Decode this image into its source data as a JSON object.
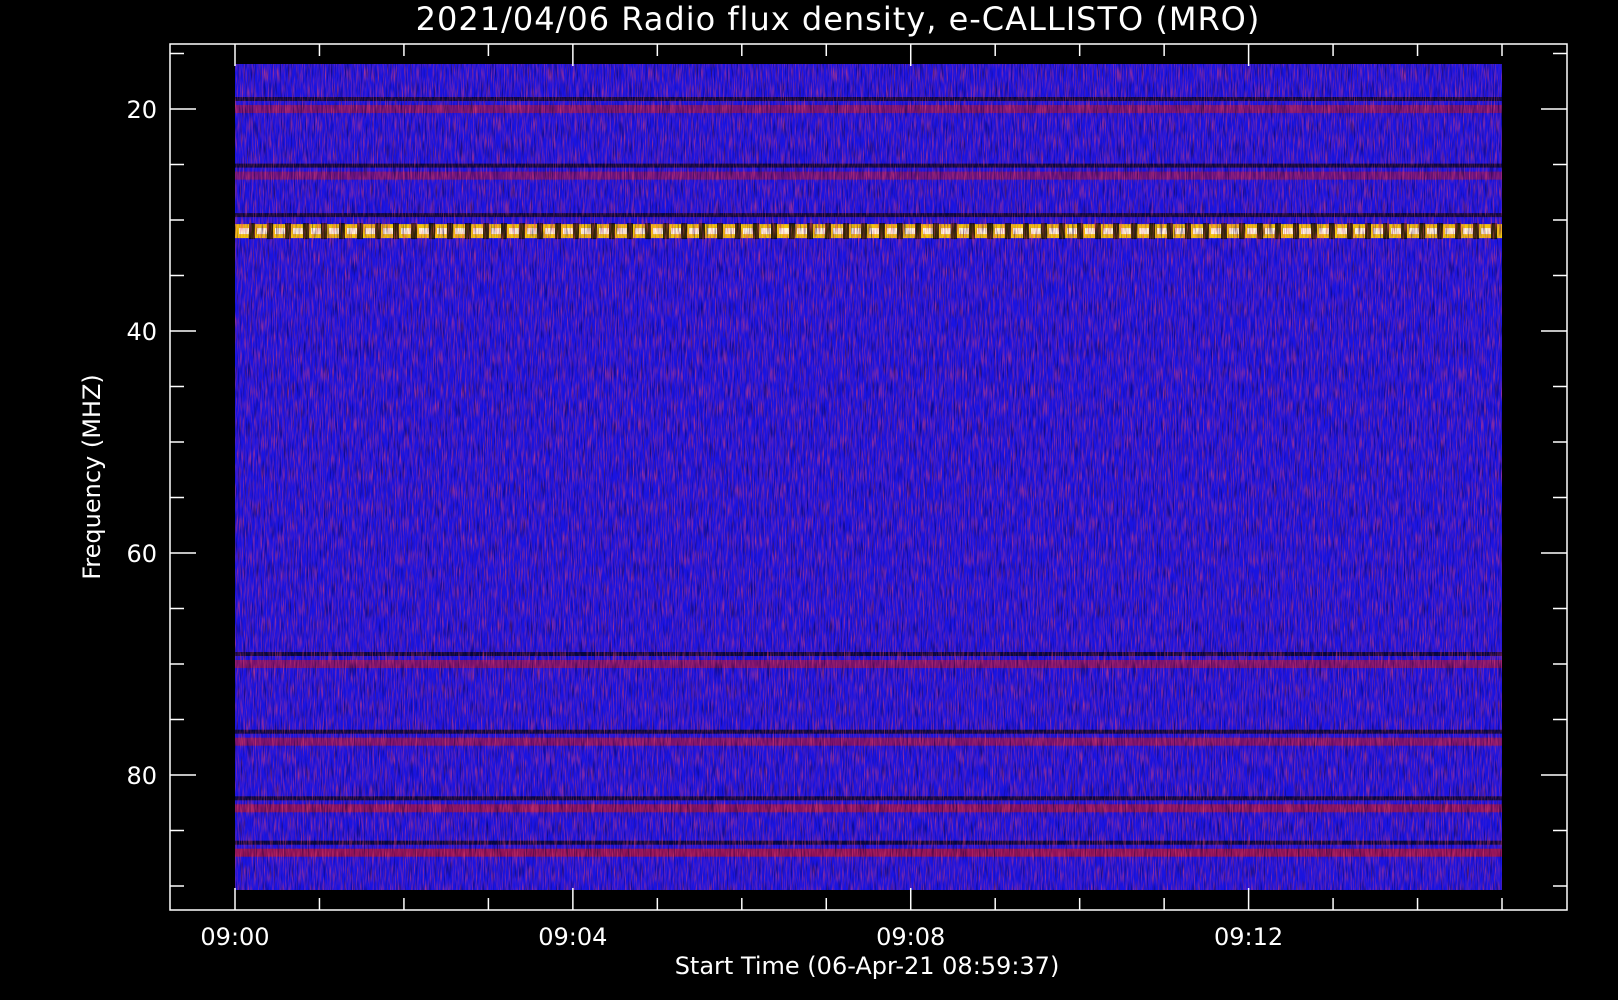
{
  "chart_data": {
    "type": "heatmap",
    "title": "2021/04/06  Radio flux density, e-CALLISTO (MRO)",
    "xlabel": "Start Time (06-Apr-21 08:59:37)",
    "ylabel": "Frequency (MHZ)",
    "x_ticks": [
      "09:00",
      "09:04",
      "09:08",
      "09:12"
    ],
    "x_tick_minutes": [
      0,
      4,
      8,
      12
    ],
    "x_range_minutes": [
      0,
      15
    ],
    "y_ticks": [
      20,
      40,
      60,
      80
    ],
    "ylim": [
      16,
      91
    ],
    "y_inverted": true,
    "colormap": [
      "#000000",
      "#1010ff",
      "#cc1010",
      "#ff6a00",
      "#ffd000",
      "#ffffff"
    ],
    "features": [
      {
        "name": "strong band",
        "freq": 31,
        "intensity": 0.95
      },
      {
        "name": "band",
        "freq": 26,
        "intensity": 0.45
      },
      {
        "name": "band",
        "freq": 20,
        "intensity": 0.5
      },
      {
        "name": "band",
        "freq": 70,
        "intensity": 0.55
      },
      {
        "name": "band",
        "freq": 77,
        "intensity": 0.55
      },
      {
        "name": "band",
        "freq": 83,
        "intensity": 0.6
      },
      {
        "name": "band",
        "freq": 87,
        "intensity": 0.65
      }
    ]
  }
}
